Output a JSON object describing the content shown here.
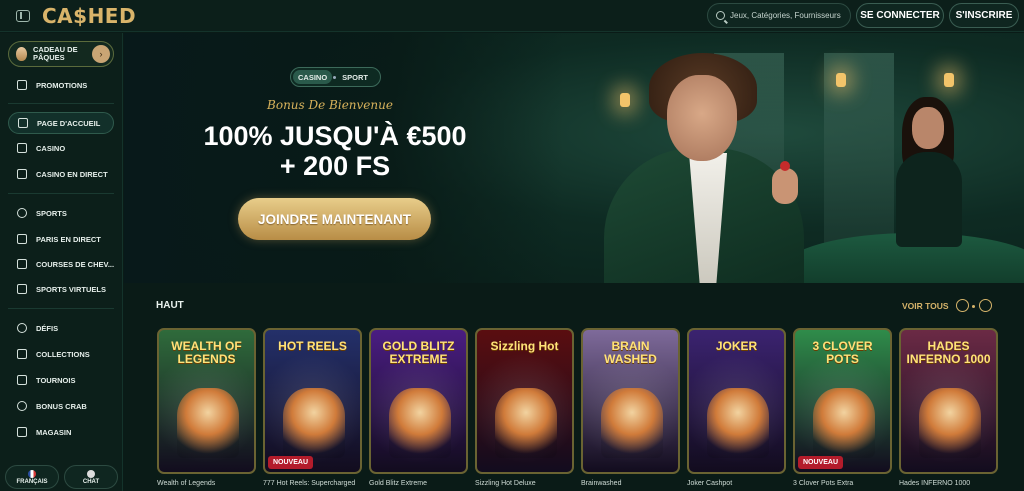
{
  "header": {
    "logo": "CA$HED",
    "search_placeholder": "Jeux, Catégories, Fournisseurs",
    "login_label": "SE CONNECTER",
    "signup_label": "S'INSCRIRE"
  },
  "sidebar": {
    "easter_label": "CADEAU DE PÂQUES",
    "items": [
      {
        "label": "PROMOTIONS",
        "icon": "gift-icon"
      },
      {
        "label": "PAGE D'ACCUEIL",
        "icon": "home-icon"
      },
      {
        "label": "CASINO",
        "icon": "slot-machine-icon"
      },
      {
        "label": "CASINO EN DIRECT",
        "icon": "live-casino-icon"
      },
      {
        "label": "SPORTS",
        "icon": "soccer-ball-icon"
      },
      {
        "label": "PARIS EN DIRECT",
        "icon": "live-bets-icon"
      },
      {
        "label": "COURSES DE CHEV...",
        "icon": "horse-icon"
      },
      {
        "label": "SPORTS VIRTUELS",
        "icon": "virtual-sports-icon"
      },
      {
        "label": "DÉFIS",
        "icon": "medal-icon"
      },
      {
        "label": "COLLECTIONS",
        "icon": "collections-icon"
      },
      {
        "label": "TOURNOIS",
        "icon": "trophy-icon"
      },
      {
        "label": "BONUS CRAB",
        "icon": "crab-icon"
      },
      {
        "label": "MAGASIN",
        "icon": "shop-bag-icon"
      }
    ],
    "language_label": "FRANÇAIS",
    "chat_label": "CHAT"
  },
  "hero": {
    "tab_casino": "CASINO",
    "tab_sport": "SPORT",
    "bonus_subtitle": "Bonus De Bienvenue",
    "bonus_line1": "100% JUSQU'À €500",
    "bonus_line2": "+ 200 FS",
    "cta_label": "JOINDRE MAINTENANT"
  },
  "section": {
    "title": "HAUT",
    "see_all": "VOIR TOUS"
  },
  "games": [
    {
      "name": "Wealth of Legends",
      "art": "WEALTH OF LEGENDS",
      "badge": "",
      "bg": "#2f6b3b"
    },
    {
      "name": "777 Hot Reels: Supercharged",
      "art": "HOT REELS",
      "badge": "NOUVEAU",
      "bg": "#24306a"
    },
    {
      "name": "Gold Blitz Extreme",
      "art": "GOLD BLITZ EXTREME",
      "badge": "",
      "bg": "#4a1d82"
    },
    {
      "name": "Sizzling Hot Deluxe",
      "art": "Sizzling Hot",
      "badge": "",
      "bg": "#5a0d10"
    },
    {
      "name": "Brainwashed",
      "art": "BRAIN WASHED",
      "badge": "",
      "bg": "#7e6a9a"
    },
    {
      "name": "Joker Cashpot",
      "art": "JOKER",
      "badge": "",
      "bg": "#3b2370"
    },
    {
      "name": "3 Clover Pots Extra",
      "art": "3 CLOVER POTS",
      "badge": "NOUVEAU",
      "bg": "#2f8c4a"
    },
    {
      "name": "Hades INFERNO 1000",
      "art": "HADES INFERNO 1000",
      "badge": "",
      "bg": "#6b2a45"
    }
  ]
}
